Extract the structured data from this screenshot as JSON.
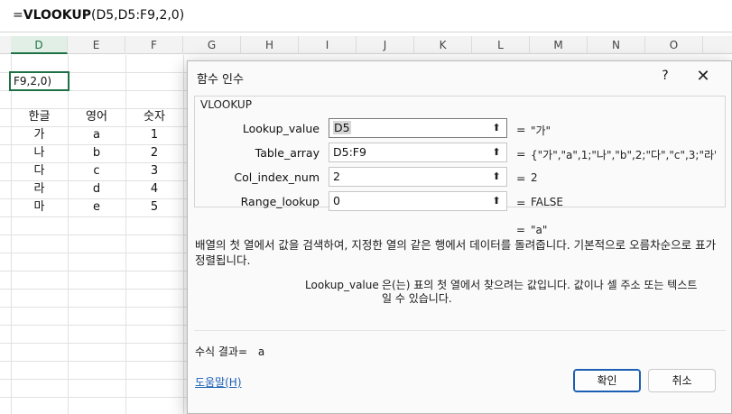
{
  "formula_bar": {
    "prefix": "=",
    "function": "VLOOKUP",
    "args": "(D5,D5:F9,2,0)"
  },
  "columns": [
    "D",
    "E",
    "F",
    "G",
    "H",
    "I",
    "J",
    "K",
    "L",
    "M",
    "N",
    "O"
  ],
  "edit_cell_text": "F9,2,0)",
  "table": {
    "headers": [
      "한글",
      "영어",
      "숫자"
    ],
    "rows": [
      [
        "가",
        "a",
        "1"
      ],
      [
        "나",
        "b",
        "2"
      ],
      [
        "다",
        "c",
        "3"
      ],
      [
        "라",
        "d",
        "4"
      ],
      [
        "마",
        "e",
        "5"
      ]
    ]
  },
  "dialog": {
    "title": "함수 인수",
    "help_icon": "?",
    "close_icon": "✕",
    "function_name": "VLOOKUP",
    "args": [
      {
        "label": "Lookup_value",
        "value_selected": "D5",
        "eq": "=",
        "result": "\"가\""
      },
      {
        "label": "Table_array",
        "value": "D5:F9",
        "eq": "=",
        "result": "{\"가\",\"a\",1;\"나\",\"b\",2;\"다\",\"c\",3;\"라\"…"
      },
      {
        "label": "Col_index_num",
        "value": "2",
        "eq": "=",
        "result": "2"
      },
      {
        "label": "Range_lookup",
        "value": "0",
        "eq": "=",
        "result": "FALSE"
      }
    ],
    "result_eq": "=",
    "result_value": "\"a\"",
    "description": "배열의 첫 열에서 값을 검색하여, 지정한 열의 같은 행에서 데이터를 돌려줍니다. 기본적으로 오름차순으로 표가 정렬됩니다.",
    "arg_help_name": "Lookup_value",
    "arg_help_text": "은(는) 표의 첫 열에서 찾으려는 값입니다. 값이나 셀 주소 또는 텍스트일 수 있습니다.",
    "formula_result_label": "수식 결과=",
    "formula_result_value": "a",
    "help_link": "도움말(H)",
    "ok_label": "확인",
    "cancel_label": "취소"
  },
  "colors": {
    "accent_green": "#1e7145",
    "link_blue": "#1a5fb4"
  }
}
